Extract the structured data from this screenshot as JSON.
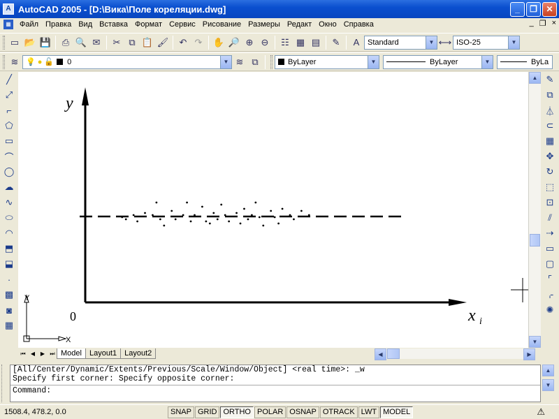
{
  "window": {
    "title": "AutoCAD 2005 - [D:\\Вика\\Поле кореляции.dwg]",
    "app_icon": "AutoCAD app icon"
  },
  "menubar": {
    "items": [
      "Файл",
      "Правка",
      "Вид",
      "Вставка",
      "Формат",
      "Сервис",
      "Рисование",
      "Размеры",
      "Редакт",
      "Окно",
      "Справка"
    ],
    "doc_controls": [
      "_",
      "❐",
      "×"
    ]
  },
  "toolbar1": {
    "text_style": "Standard",
    "dim_style": "ISO-25"
  },
  "toolbar2": {
    "layer": "0",
    "color": "ByLayer",
    "linetype": "ByLayer",
    "lineweight": "ByLa"
  },
  "drawing": {
    "y_axis_label": "y",
    "x_axis_label": "x",
    "x_axis_subscript": "i",
    "origin_label": "0",
    "ucs_x": "X",
    "ucs_y": "Y",
    "scatter_points": [
      [
        0.06,
        0.54
      ],
      [
        0.07,
        0.55
      ],
      [
        0.09,
        0.53
      ],
      [
        0.1,
        0.56
      ],
      [
        0.12,
        0.52
      ],
      [
        0.14,
        0.53
      ],
      [
        0.15,
        0.47
      ],
      [
        0.16,
        0.55
      ],
      [
        0.17,
        0.58
      ],
      [
        0.19,
        0.51
      ],
      [
        0.2,
        0.55
      ],
      [
        0.22,
        0.53
      ],
      [
        0.23,
        0.47
      ],
      [
        0.24,
        0.56
      ],
      [
        0.25,
        0.53
      ],
      [
        0.27,
        0.49
      ],
      [
        0.28,
        0.56
      ],
      [
        0.29,
        0.57
      ],
      [
        0.3,
        0.52
      ],
      [
        0.31,
        0.55
      ],
      [
        0.32,
        0.48
      ],
      [
        0.33,
        0.53
      ],
      [
        0.34,
        0.56
      ],
      [
        0.36,
        0.52
      ],
      [
        0.37,
        0.57
      ],
      [
        0.38,
        0.5
      ],
      [
        0.39,
        0.55
      ],
      [
        0.4,
        0.53
      ],
      [
        0.41,
        0.47
      ],
      [
        0.42,
        0.54
      ],
      [
        0.43,
        0.58
      ],
      [
        0.45,
        0.51
      ],
      [
        0.46,
        0.54
      ],
      [
        0.47,
        0.57
      ],
      [
        0.48,
        0.5
      ],
      [
        0.5,
        0.53
      ],
      [
        0.51,
        0.55
      ],
      [
        0.53,
        0.51
      ],
      [
        0.55,
        0.53
      ]
    ]
  },
  "tabs": [
    "Model",
    "Layout1",
    "Layout2"
  ],
  "command": {
    "history": [
      "[All/Center/Dynamic/Extents/Previous/Scale/Window/Object] <real time>: _w",
      "Specify first corner: Specify opposite corner:"
    ],
    "prompt": "Command:"
  },
  "status": {
    "coords": "1508.4, 478.2, 0.0",
    "toggles": [
      "SNAP",
      "GRID",
      "ORTHO",
      "POLAR",
      "OSNAP",
      "OTRACK",
      "LWT",
      "MODEL"
    ]
  }
}
